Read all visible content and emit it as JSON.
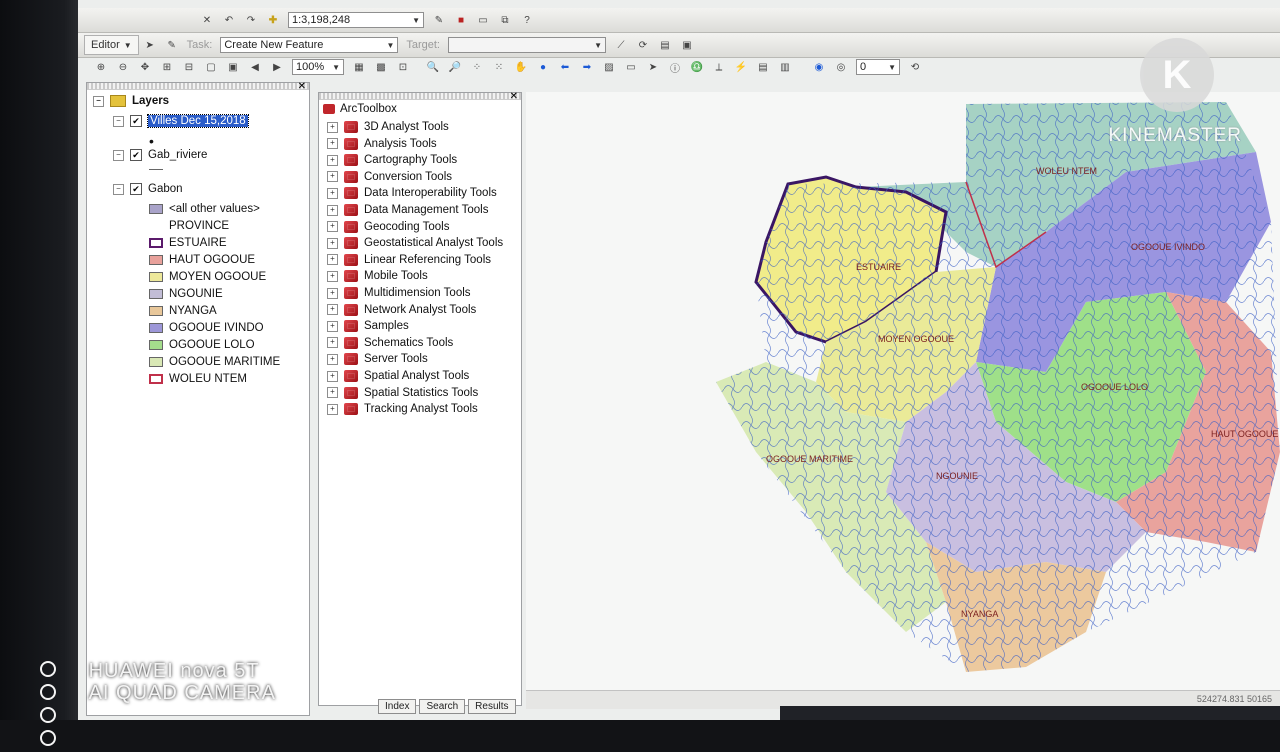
{
  "toolbar": {
    "scale": "1:3,198,248",
    "editor_label": "Editor",
    "task_label": "Task:",
    "task_value": "Create New Feature",
    "target_label": "Target:",
    "target_value": "",
    "zoom_percent": "100%",
    "layer_index": "0"
  },
  "toc": {
    "root": "Layers",
    "layers": [
      {
        "name": "Villes Dec 15,2018",
        "selected": true
      },
      {
        "name": "Gab_riviere"
      },
      {
        "name": "Gabon"
      }
    ],
    "legend": [
      {
        "label": "<all other values>",
        "color": "#a9a3c9"
      },
      {
        "label": "PROVINCE",
        "color": ""
      },
      {
        "label": "ESTUAIRE",
        "color": "#ffffff",
        "border": "#5b1a6b"
      },
      {
        "label": "HAUT OGOOUE",
        "color": "#e8a19b"
      },
      {
        "label": "MOYEN OGOOUE",
        "color": "#ede89a"
      },
      {
        "label": "NGOUNIE",
        "color": "#c2bdd6"
      },
      {
        "label": "NYANGA",
        "color": "#e8c79a"
      },
      {
        "label": "OGOOUE IVINDO",
        "color": "#9d97d8"
      },
      {
        "label": "OGOOUE LOLO",
        "color": "#a4dd8c"
      },
      {
        "label": "OGOOUE MARITIME",
        "color": "#d9e8b5"
      },
      {
        "label": "WOLEU NTEM",
        "color": "#ffffff",
        "border": "#c0304a"
      }
    ]
  },
  "toolbox": {
    "root": "ArcToolbox",
    "items": [
      "3D Analyst Tools",
      "Analysis Tools",
      "Cartography Tools",
      "Conversion Tools",
      "Data Interoperability Tools",
      "Data Management Tools",
      "Geocoding Tools",
      "Geostatistical Analyst Tools",
      "Linear Referencing Tools",
      "Mobile Tools",
      "Multidimension Tools",
      "Network Analyst Tools",
      "Samples",
      "Schematics Tools",
      "Server Tools",
      "Spatial Analyst Tools",
      "Spatial Statistics Tools",
      "Tracking Analyst Tools"
    ],
    "tabs": [
      "Index",
      "Search",
      "Results"
    ]
  },
  "map": {
    "provinces": {
      "woleu_ntem": "WOLEU NTEM",
      "estuaire": "ESTUAIRE",
      "ogooue_ivindo": "OGOOUE IVINDO",
      "moyen_ogooue": "MOYEN OGOOUE",
      "ogooue_lolo": "OGOOUE LOLO",
      "haut_ogooue": "HAUT OGOOUE",
      "ogooue_maritime": "OGOOUE MARITIME",
      "ngounie": "NGOUNIE",
      "nyanga": "NYANGA"
    },
    "coords": "524274.831 50165"
  },
  "overlay": {
    "brand": "KINEMASTER",
    "camera_line1": "HUAWEI nova 5T",
    "camera_line2": "AI QUAD CAMERA"
  }
}
